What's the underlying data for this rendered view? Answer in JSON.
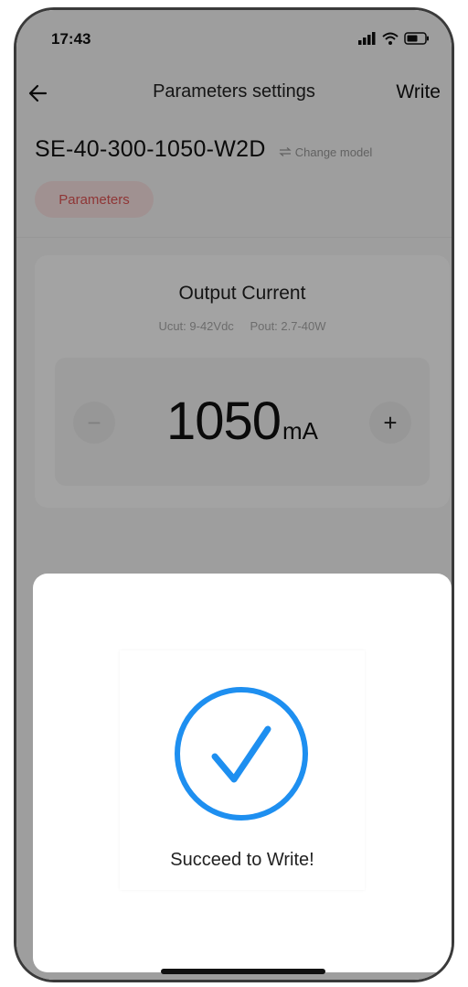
{
  "status_bar": {
    "time": "17:43"
  },
  "nav": {
    "title": "Parameters settings",
    "write_label": "Write"
  },
  "model": {
    "name": "SE-40-300-1050-W2D",
    "change_label": "Change model"
  },
  "tabs": [
    {
      "label": "Parameters",
      "active": true
    }
  ],
  "output_card": {
    "title": "Output Current",
    "ucut": "Ucut: 9-42Vdc",
    "pout": "Pout: 2.7-40W",
    "value": "1050",
    "unit": "mA",
    "minus_label": "−",
    "plus_label": "+"
  },
  "dialog": {
    "message": "Succeed to Write!"
  },
  "colors": {
    "accent_blue": "#1e8ff0",
    "tab_red": "#e05555",
    "tab_bg": "#fbe3e3"
  },
  "icons": {
    "back": "arrow-left-icon",
    "signal": "cellular-signal-icon",
    "wifi": "wifi-icon",
    "battery": "battery-icon",
    "swap": "swap-arrows-icon",
    "success": "check-circle-icon"
  }
}
